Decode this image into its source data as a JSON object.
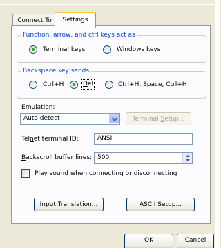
{
  "tabs": [
    {
      "label": "Connect To",
      "active": false
    },
    {
      "label": "Settings",
      "active": true
    }
  ],
  "function_keys_group": {
    "title": "Function, arrow, and ctrl keys act as",
    "options": [
      {
        "label": "Terminal keys",
        "mnemonic": "T",
        "rest": "erminal keys",
        "selected": true
      },
      {
        "label": "Windows keys",
        "mnemonic": "W",
        "rest": "indows keys",
        "selected": false
      }
    ]
  },
  "backspace_group": {
    "title": "Backspace key sends",
    "options": [
      {
        "label": "Ctrl+H",
        "mnemonic": "C",
        "rest": "trl+H",
        "selected": false
      },
      {
        "label": "Del",
        "mnemonic": "D",
        "rest": "el",
        "selected": true
      },
      {
        "label": "Ctrl+H, Space, Ctrl+H",
        "pre": "Ctrl+",
        "mnemonic": "H",
        "rest": ", Space, Ctrl+H",
        "selected": false
      }
    ]
  },
  "emulation": {
    "label_mnemonic": "E",
    "label_rest": "mulation:",
    "value": "Auto detect",
    "terminal_setup": {
      "pre": "Terminal ",
      "mnemonic": "S",
      "rest": "etup..."
    }
  },
  "telnet": {
    "label_pre": "Tel",
    "label_mnemonic": "n",
    "label_rest": "et terminal ID:",
    "value": "ANSI"
  },
  "backscroll": {
    "label_mnemonic": "B",
    "label_rest": "ackscroll buffer lines:",
    "value": "500"
  },
  "play_sound": {
    "mnemonic": "P",
    "rest": "lay sound when connecting or disconnecting",
    "checked": false
  },
  "buttons": {
    "input_translation": {
      "mnemonic": "I",
      "rest": "nput Translation..."
    },
    "ascii_setup": {
      "mnemonic": "A",
      "rest": "SCII Setup..."
    },
    "ok": "OK",
    "cancel": "Cancel"
  },
  "colors": {
    "accent_blue": "#0046d5",
    "tab_highlight": "#ffc83c",
    "radio_dot": "#21a121"
  }
}
